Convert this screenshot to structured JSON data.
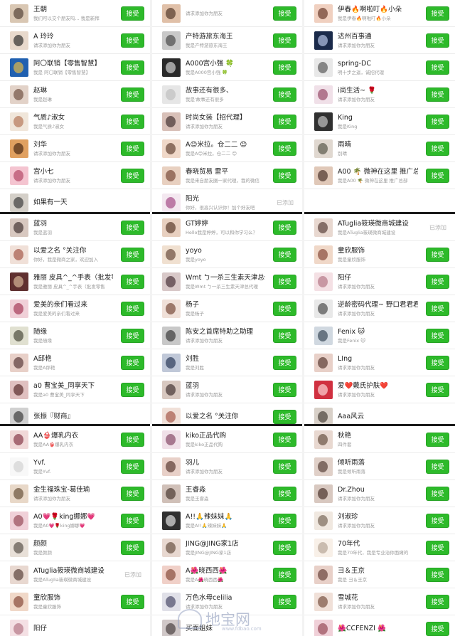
{
  "accept_label": "接受",
  "added_label": "已添加",
  "watermark": {
    "text": "地宝网",
    "url": "www.fdbao.com"
  },
  "panels": [
    {
      "rows": [
        {
          "name": "王朝",
          "sub": "我们可以交个朋友吗...  我是新拜",
          "c1": "#d9c7b3",
          "c2": "#4b3a30",
          "action": "accept"
        },
        {
          "name": "A 玲玲",
          "sub": "请求添加你为朋友",
          "c1": "#e8d9cc",
          "c2": "#222",
          "action": "accept"
        },
        {
          "name": "阿〇联销【零售智慧】",
          "sub": "我是 阿〇联销【零售智慧】",
          "c1": "#2060b0",
          "c2": "#f0c040",
          "action": "accept"
        },
        {
          "name": "赵琳",
          "sub": "我是赵琳",
          "c1": "#e2d2c8",
          "c2": "#6a4a3a",
          "action": "accept"
        },
        {
          "name": "气质♪淑女",
          "sub": "我是气质♪淑女",
          "c1": "#f0e6da",
          "c2": "#b07050",
          "action": "accept"
        },
        {
          "name": "刘华",
          "sub": "请求添加你为朋友",
          "c1": "#e0a060",
          "c2": "#402010",
          "action": "accept"
        },
        {
          "name": "宫小七",
          "sub": "请求添加你为朋友",
          "c1": "#f4c4d0",
          "c2": "#b04060",
          "action": "accept"
        },
        {
          "name": "如果有一天",
          "sub": "",
          "c1": "#d4cfc8",
          "c2": "#333",
          "action": "none"
        }
      ]
    },
    {
      "rows": [
        {
          "name": "",
          "sub": "请求添加你为朋友",
          "c1": "#e0c0a8",
          "c2": "#4a3020",
          "action": "accept"
        },
        {
          "name": "产特游旅东海王",
          "sub": "我是产特游旅东海王",
          "c1": "#c8c8c8",
          "c2": "#404040",
          "action": "accept"
        },
        {
          "name": "A000宫小强 🍀",
          "sub": "我是A000宫小强 🍀",
          "c1": "#2a2a2a",
          "c2": "#e0e0e0",
          "action": "accept"
        },
        {
          "name": "故事还有很多、",
          "sub": "我是'故事还有很多",
          "c1": "#e6e6e6",
          "c2": "#bdbdbd",
          "action": "accept"
        },
        {
          "name": "时尚女装【招代理】",
          "sub": "请求添加你为朋友",
          "c1": "#d8c0b8",
          "c2": "#3a2a2a",
          "action": "accept"
        },
        {
          "name": "A😊米拉。仓二二 😊",
          "sub": "我是A😊米拉。仓二二 😊",
          "c1": "#f0d8c8",
          "c2": "#5a3a2a",
          "action": "accept"
        },
        {
          "name": "春晓贸易 雷平",
          "sub": "我是来自朋友圈一家代理，我的微信",
          "c1": "#e8d0c0",
          "c2": "#704030",
          "action": "accept"
        },
        {
          "name": "阳光",
          "sub": "你好，很高兴认识你！加个好友吧",
          "c1": "#f4e8f0",
          "c2": "#a04080",
          "action": "added"
        }
      ]
    },
    {
      "rows": [
        {
          "name": "伊春🔥啊啦叮🔥小朵",
          "sub": "我是伊春🔥啊啦叮🔥小朵",
          "c1": "#f0d0c0",
          "c2": "#603020",
          "action": "accept"
        },
        {
          "name": "达州百事通",
          "sub": "请求添加你为朋友",
          "c1": "#1a2a4a",
          "c2": "#c0d0f0",
          "action": "accept"
        },
        {
          "name": "spring-DC",
          "sub": "明十步之遥，诚招代理",
          "c1": "#e8e8e8",
          "c2": "#505050",
          "action": "accept"
        },
        {
          "name": "i尚生活~ 🌹",
          "sub": "请求添加你为朋友",
          "c1": "#f0e0e8",
          "c2": "#904060",
          "action": "accept"
        },
        {
          "name": "King",
          "sub": "我是King",
          "c1": "#303030",
          "c2": "#d0d0d0",
          "action": "accept"
        },
        {
          "name": "雨晴",
          "sub": "别晴",
          "c1": "#e0d8d0",
          "c2": "#505040",
          "action": "accept"
        },
        {
          "name": "A00 🌴 微神在这里 推广总部",
          "sub": "我是A00 🌴 微神在这里 推广总部",
          "c1": "#e0c8b8",
          "c2": "#402820",
          "action": "accept"
        }
      ]
    },
    {
      "rows": [
        {
          "name": "蓝羽",
          "sub": "我是蓝羽",
          "c1": "#d8c8c0",
          "c2": "#3a2a2a",
          "action": "accept"
        },
        {
          "name": "以爱之名 °关注你",
          "sub": "你好，我是微商之家，欢迎加入",
          "c1": "#f0e0d8",
          "c2": "#a05040",
          "action": "accept"
        },
        {
          "name": "雅丽 皮具^_^手表（批发零售",
          "sub": "我是雅丽 皮具^_^手表（批发零售",
          "c1": "#603030",
          "c2": "#e0c0a0",
          "action": "accept"
        },
        {
          "name": "爱美的亲们看过来",
          "sub": "我是爱美的亲们看过来",
          "c1": "#f0d0d8",
          "c2": "#a03050",
          "action": "accept"
        },
        {
          "name": "随缘",
          "sub": "我是随缘",
          "c1": "#e0e0d0",
          "c2": "#404030",
          "action": "accept"
        },
        {
          "name": "A邱艳",
          "sub": "我是A邱艳",
          "c1": "#e8d0c8",
          "c2": "#503030",
          "action": "accept"
        },
        {
          "name": "a0 曹宝美_同享天下",
          "sub": "我是a0 曹宝美_同享天下",
          "c1": "#e0c0c0",
          "c2": "#502020",
          "action": "accept"
        },
        {
          "name": "张振『财商』",
          "sub": "",
          "c1": "#d0d0d0",
          "c2": "#303030",
          "action": "none"
        }
      ]
    },
    {
      "rows": [
        {
          "name": "GT婷婷",
          "sub": "Hello我是婷婷，可以和你学习么？",
          "c1": "#e8d0c0",
          "c2": "#503020",
          "action": "accept"
        },
        {
          "name": "yoyo",
          "sub": "我是yoyo",
          "c1": "#f0e0d0",
          "c2": "#604030",
          "action": "accept"
        },
        {
          "name": "Wmt ㄅ一杀三生素天津总代理",
          "sub": "我是Wmt ㄅ一杀三生素天津总代理",
          "c1": "#d8c8c8",
          "c2": "#402830",
          "action": "accept"
        },
        {
          "name": "杨子",
          "sub": "我是杨子",
          "c1": "#f0e0d8",
          "c2": "#704030",
          "action": "accept"
        },
        {
          "name": "陈安之首席特助之助理",
          "sub": "请求添加你为朋友",
          "c1": "#c8c8c8",
          "c2": "#303030",
          "action": "accept"
        },
        {
          "name": "刘胜",
          "sub": "我是刘胜",
          "c1": "#c0c8d8",
          "c2": "#203050",
          "action": "accept"
        },
        {
          "name": "蓝羽",
          "sub": "请求添加你为朋友",
          "c1": "#d8c8c0",
          "c2": "#3a2a2a",
          "action": "accept"
        },
        {
          "name": "以爱之名 °关注你",
          "sub": "",
          "c1": "#f0e0d8",
          "c2": "#a05040",
          "action": "accept"
        }
      ]
    },
    {
      "rows": [
        {
          "name": "ATuglia筱瑛微商城建设",
          "sub": "我是ATuglia筱瑛微商城建设",
          "c1": "#e8d8d0",
          "c2": "#503830",
          "action": "added"
        },
        {
          "name": "童欣服饰",
          "sub": "我是童欣服饰",
          "c1": "#f0d8c8",
          "c2": "#804030",
          "action": "accept"
        },
        {
          "name": "阳仔",
          "sub": "请求添加你为朋友",
          "c1": "#f4e0e4",
          "c2": "#b07080",
          "action": "accept"
        },
        {
          "name": "逆龄密码代理~ 野口君君君君",
          "sub": "请求添加你为朋友",
          "c1": "#e8e8e8",
          "c2": "#404040",
          "action": "accept"
        },
        {
          "name": "Fenix 🐱",
          "sub": "我是Fenix 🐱",
          "c1": "#d0d8e0",
          "c2": "#304050",
          "action": "accept"
        },
        {
          "name": "LIng",
          "sub": "请求添加你为朋友",
          "c1": "#e8d0c8",
          "c2": "#503028",
          "action": "accept"
        },
        {
          "name": "爱❤️戴氏护肤❤️",
          "sub": "请求添加你为朋友",
          "c1": "#d03040",
          "c2": "#ffe0e0",
          "action": "accept"
        },
        {
          "name": "Aaa风云",
          "sub": "",
          "c1": "#d8d0c8",
          "c2": "#403830",
          "action": "none"
        }
      ]
    },
    {
      "rows": [
        {
          "name": "AA👙爆乳内衣",
          "sub": "我是AA👙爆乳内衣",
          "c1": "#f0d8d8",
          "c2": "#803040",
          "action": "accept"
        },
        {
          "name": "Yvf.",
          "sub": "我是Yvf.",
          "c1": "#f8f8f8",
          "c2": "#d0d0d0",
          "action": "accept"
        },
        {
          "name": "金生福珠宝-葛佳瑜",
          "sub": "请求添加你为朋友",
          "c1": "#e8d8c8",
          "c2": "#604830",
          "action": "accept"
        },
        {
          "name": "A0💗🌹king娜娜💗",
          "sub": "我是A0💗🌹king娜娜💗",
          "c1": "#f0d0d8",
          "c2": "#904050",
          "action": "accept"
        },
        {
          "name": "颜颜",
          "sub": "我是颜颜",
          "c1": "#e8e0d8",
          "c2": "#504840",
          "action": "accept"
        },
        {
          "name": "ATuglia筱瑛微商城建设",
          "sub": "我是ATuglia筱瑛微商城建设",
          "c1": "#e8d8d0",
          "c2": "#503830",
          "action": "added"
        },
        {
          "name": "童欣服饰",
          "sub": "我是童欣服饰",
          "c1": "#f0d8c8",
          "c2": "#804030",
          "action": "accept"
        },
        {
          "name": "阳仔",
          "sub": "",
          "c1": "#f4e0e4",
          "c2": "#b07080",
          "action": "none"
        }
      ]
    },
    {
      "rows": [
        {
          "name": "kiko正品代购",
          "sub": "我是kiko正品代购",
          "c1": "#f0e0e8",
          "c2": "#804060",
          "action": "accept"
        },
        {
          "name": "羽儿",
          "sub": "请求添加你为朋友",
          "c1": "#e8d0c8",
          "c2": "#503028",
          "action": "accept"
        },
        {
          "name": "王睿淼",
          "sub": "我是王睿淼",
          "c1": "#d0c0b8",
          "c2": "#403028",
          "action": "accept"
        },
        {
          "name": "A!!🙏辣妹妹🙏",
          "sub": "我是A!!🙏辣妹妹🙏",
          "c1": "#303030",
          "c2": "#f0f0f0",
          "action": "accept"
        },
        {
          "name": "JING@JING家1店",
          "sub": "我是JING@JING家1店",
          "c1": "#e8d8d0",
          "c2": "#604838",
          "action": "accept"
        },
        {
          "name": "A🌺晓西西🌺",
          "sub": "我是A🌺晓西西🌺",
          "c1": "#f0d0c8",
          "c2": "#804030",
          "action": "accept"
        },
        {
          "name": "万色水母celilia",
          "sub": "请求添加你为朋友",
          "c1": "#e0e0e8",
          "c2": "#404060",
          "action": "accept"
        },
        {
          "name": "买面姐妹",
          "sub": "",
          "c1": "#d0c8c8",
          "c2": "#403838",
          "action": "none"
        }
      ]
    },
    {
      "rows": [
        {
          "name": "秋艳",
          "sub": "四件套",
          "c1": "#e8d8d0",
          "c2": "#604838",
          "action": "accept"
        },
        {
          "name": "倾听雨落",
          "sub": "我是倾听雨落",
          "c1": "#e0d0c8",
          "c2": "#503830",
          "action": "accept"
        },
        {
          "name": "Dr.Zhou",
          "sub": "请求添加你为朋友",
          "c1": "#d8c8c0",
          "c2": "#402820",
          "action": "accept"
        },
        {
          "name": "刘淑珍",
          "sub": "请求添加你为朋友",
          "c1": "#f0e8e0",
          "c2": "#706050",
          "action": "accept"
        },
        {
          "name": "70年代",
          "sub": "我是70年代，我是专业治你面瘫的",
          "c1": "#f8f0e8",
          "c2": "#b0a090",
          "action": "accept"
        },
        {
          "name": "彐＆王京",
          "sub": "我是 彐＆王京",
          "c1": "#e8d0c8",
          "c2": "#603830",
          "action": "accept"
        },
        {
          "name": "雪城花",
          "sub": "请求添加你为朋友",
          "c1": "#f0e0d8",
          "c2": "#704838",
          "action": "accept"
        },
        {
          "name": "🌺CCFENZI 🌺",
          "sub": "",
          "c1": "#f0d0d8",
          "c2": "#904050",
          "action": "accept"
        }
      ]
    }
  ]
}
